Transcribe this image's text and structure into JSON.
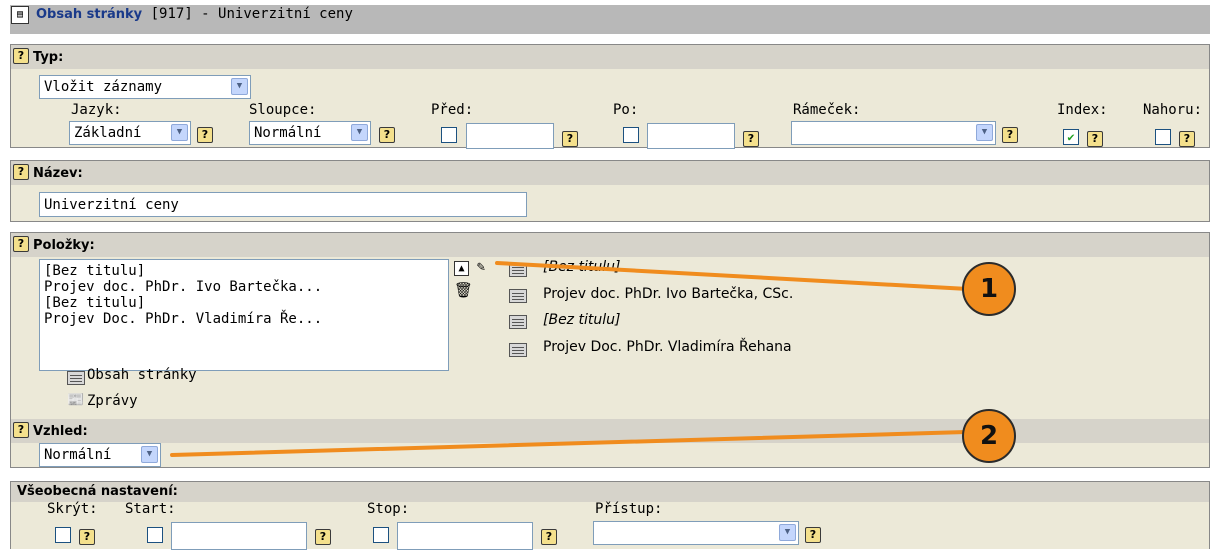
{
  "titlebar": {
    "title_bold": "Obsah stránky",
    "title_rest": " [917] - Univerzitní ceny",
    "icon": "page-content-icon"
  },
  "help": {
    "glyph": "?"
  },
  "typ": {
    "heading": "Typ:",
    "type_select": "Vložit záznamy",
    "labels": {
      "jazyk": "Jazyk:",
      "sloupce": "Sloupce:",
      "pred": "Před:",
      "po": "Po:",
      "ramecek": "Rámeček:",
      "index": "Index:",
      "nahoru": "Nahoru:"
    },
    "jazyk_value": "Základní",
    "sloupce_value": "Normální",
    "pred_value": "",
    "po_value": "",
    "ramecek_value": "",
    "index_checked": "✔",
    "nahoru_checked": ""
  },
  "nazev": {
    "heading": "Název:",
    "value": "Univerzitní ceny"
  },
  "polozky": {
    "heading": "Položky:",
    "list": [
      "[Bez titulu]",
      "Projev doc. PhDr. Ivo Bartečka...",
      "[Bez titulu]",
      "Projev Doc. PhDr. Vladimíra Ře..."
    ],
    "items": [
      "[Bez titulu]",
      "Projev doc. PhDr. Ivo Bartečka, CSc.",
      "[Bez titulu]",
      "Projev Doc. PhDr. Vladimíra Řehana"
    ],
    "links": {
      "obsah": "Obsah stránky",
      "zpravy": "Zprávy"
    },
    "icons": {
      "up": "move-up-icon",
      "edit": "edit-icon",
      "delete": "trash-icon"
    }
  },
  "vzhled": {
    "heading": "Vzhled:",
    "value": "Normální"
  },
  "vseobecna": {
    "heading": "Všeobecná nastavení:",
    "labels": {
      "skryt": "Skrýt:",
      "start": "Start:",
      "stop": "Stop:",
      "pristup": "Přístup:"
    },
    "start_value": "",
    "stop_value": "",
    "pristup_value": ""
  },
  "callouts": {
    "one": "1",
    "two": "2",
    "color": "#f08c1e"
  }
}
